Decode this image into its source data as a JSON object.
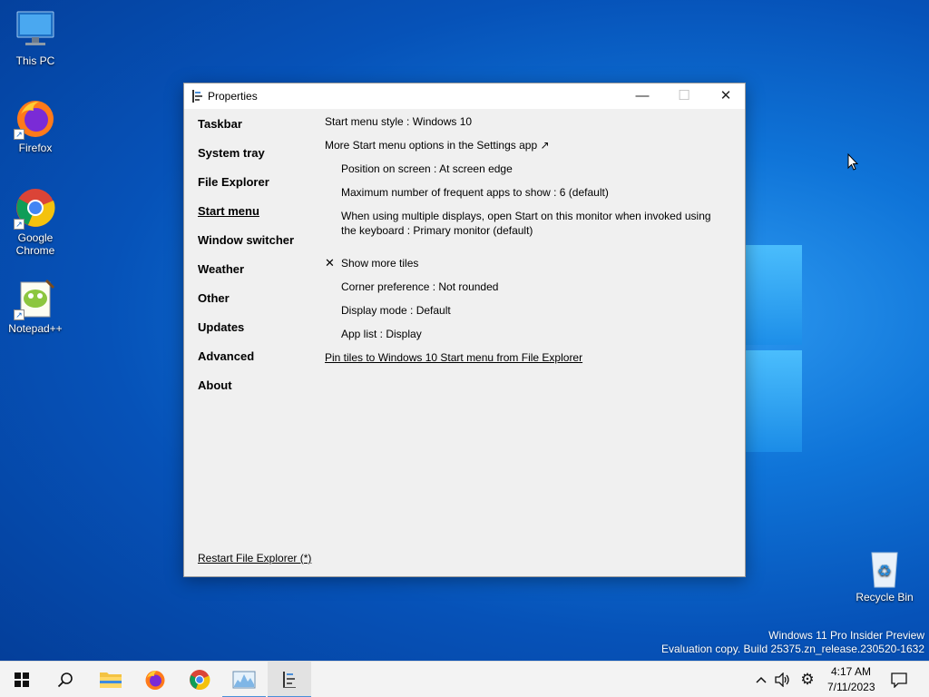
{
  "desktop": {
    "icons": [
      {
        "label": "This PC"
      },
      {
        "label": "Firefox"
      },
      {
        "label": "Google Chrome"
      },
      {
        "label": "Notepad++"
      },
      {
        "label": "Recycle Bin"
      }
    ],
    "watermark_line1": "Windows 11 Pro Insider Preview",
    "watermark_line2": "Evaluation copy. Build 25375.zn_release.230520-1632"
  },
  "window": {
    "title": "Properties",
    "minimize_glyph": "—",
    "maximize_glyph": "☐",
    "close_glyph": "✕"
  },
  "nav": {
    "items": [
      {
        "label": "Taskbar"
      },
      {
        "label": "System tray"
      },
      {
        "label": "File Explorer"
      },
      {
        "label": "Start menu",
        "active": true
      },
      {
        "label": "Window switcher"
      },
      {
        "label": "Weather"
      },
      {
        "label": "Other"
      },
      {
        "label": "Updates"
      },
      {
        "label": "Advanced"
      },
      {
        "label": "About"
      }
    ],
    "restart_label": "Restart File Explorer (*)"
  },
  "options": {
    "start_menu_style": "Start menu style : Windows 10",
    "more_options": "More Start menu options in the Settings app ↗",
    "position": "Position on screen : At screen edge",
    "max_frequent": "Maximum number of frequent apps to show : 6 (default)",
    "multi_display": "When using multiple displays, open Start on this monitor when invoked using the keyboard : Primary monitor (default)",
    "show_more_tiles_check": "✕",
    "show_more_tiles": "Show more tiles",
    "corner_pref": "Corner preference : Not rounded",
    "display_mode": "Display mode : Default",
    "app_list": "App list : Display",
    "pin_tiles": "Pin tiles to Windows 10 Start menu from File Explorer"
  },
  "taskbar": {
    "time": "4:17 AM",
    "date": "7/11/2023"
  },
  "colors": {
    "accent": "#4a8fd9",
    "window_bg": "#f0f0f0"
  }
}
